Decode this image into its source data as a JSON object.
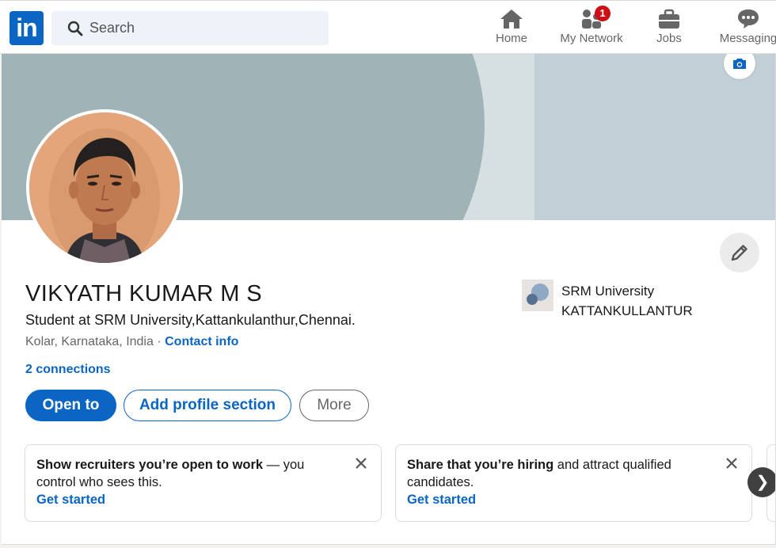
{
  "nav": {
    "logo_text": "in",
    "search_placeholder": "Search",
    "items": [
      {
        "label": "Home",
        "icon": "home-icon"
      },
      {
        "label": "My Network",
        "icon": "people-icon",
        "badge": "1"
      },
      {
        "label": "Jobs",
        "icon": "briefcase-icon"
      },
      {
        "label": "Messaging",
        "icon": "chat-icon"
      }
    ],
    "brand_color": "#0a66c2",
    "badge_color": "#cc1016"
  },
  "profile": {
    "name": "VIKYATH KUMAR M S",
    "headline": "Student at SRM University,Kattankulanthur,Chennai.",
    "location": "Kolar, Karnataka, India",
    "separator": " · ",
    "contact_label": "Contact info",
    "connections": "2 connections",
    "school_line1": "SRM University",
    "school_line2": "KATTANKULLANTUR"
  },
  "actions": {
    "open_to": "Open to",
    "add_section": "Add profile section",
    "more": "More"
  },
  "promos": [
    {
      "strong": "Show recruiters you’re open to work",
      "rest": " — you control who sees this.",
      "link": "Get started"
    },
    {
      "strong": "Share that you’re hiring",
      "rest": " and attract qualified candidates.",
      "link": "Get started"
    }
  ],
  "carousel_next_glyph": "❯"
}
